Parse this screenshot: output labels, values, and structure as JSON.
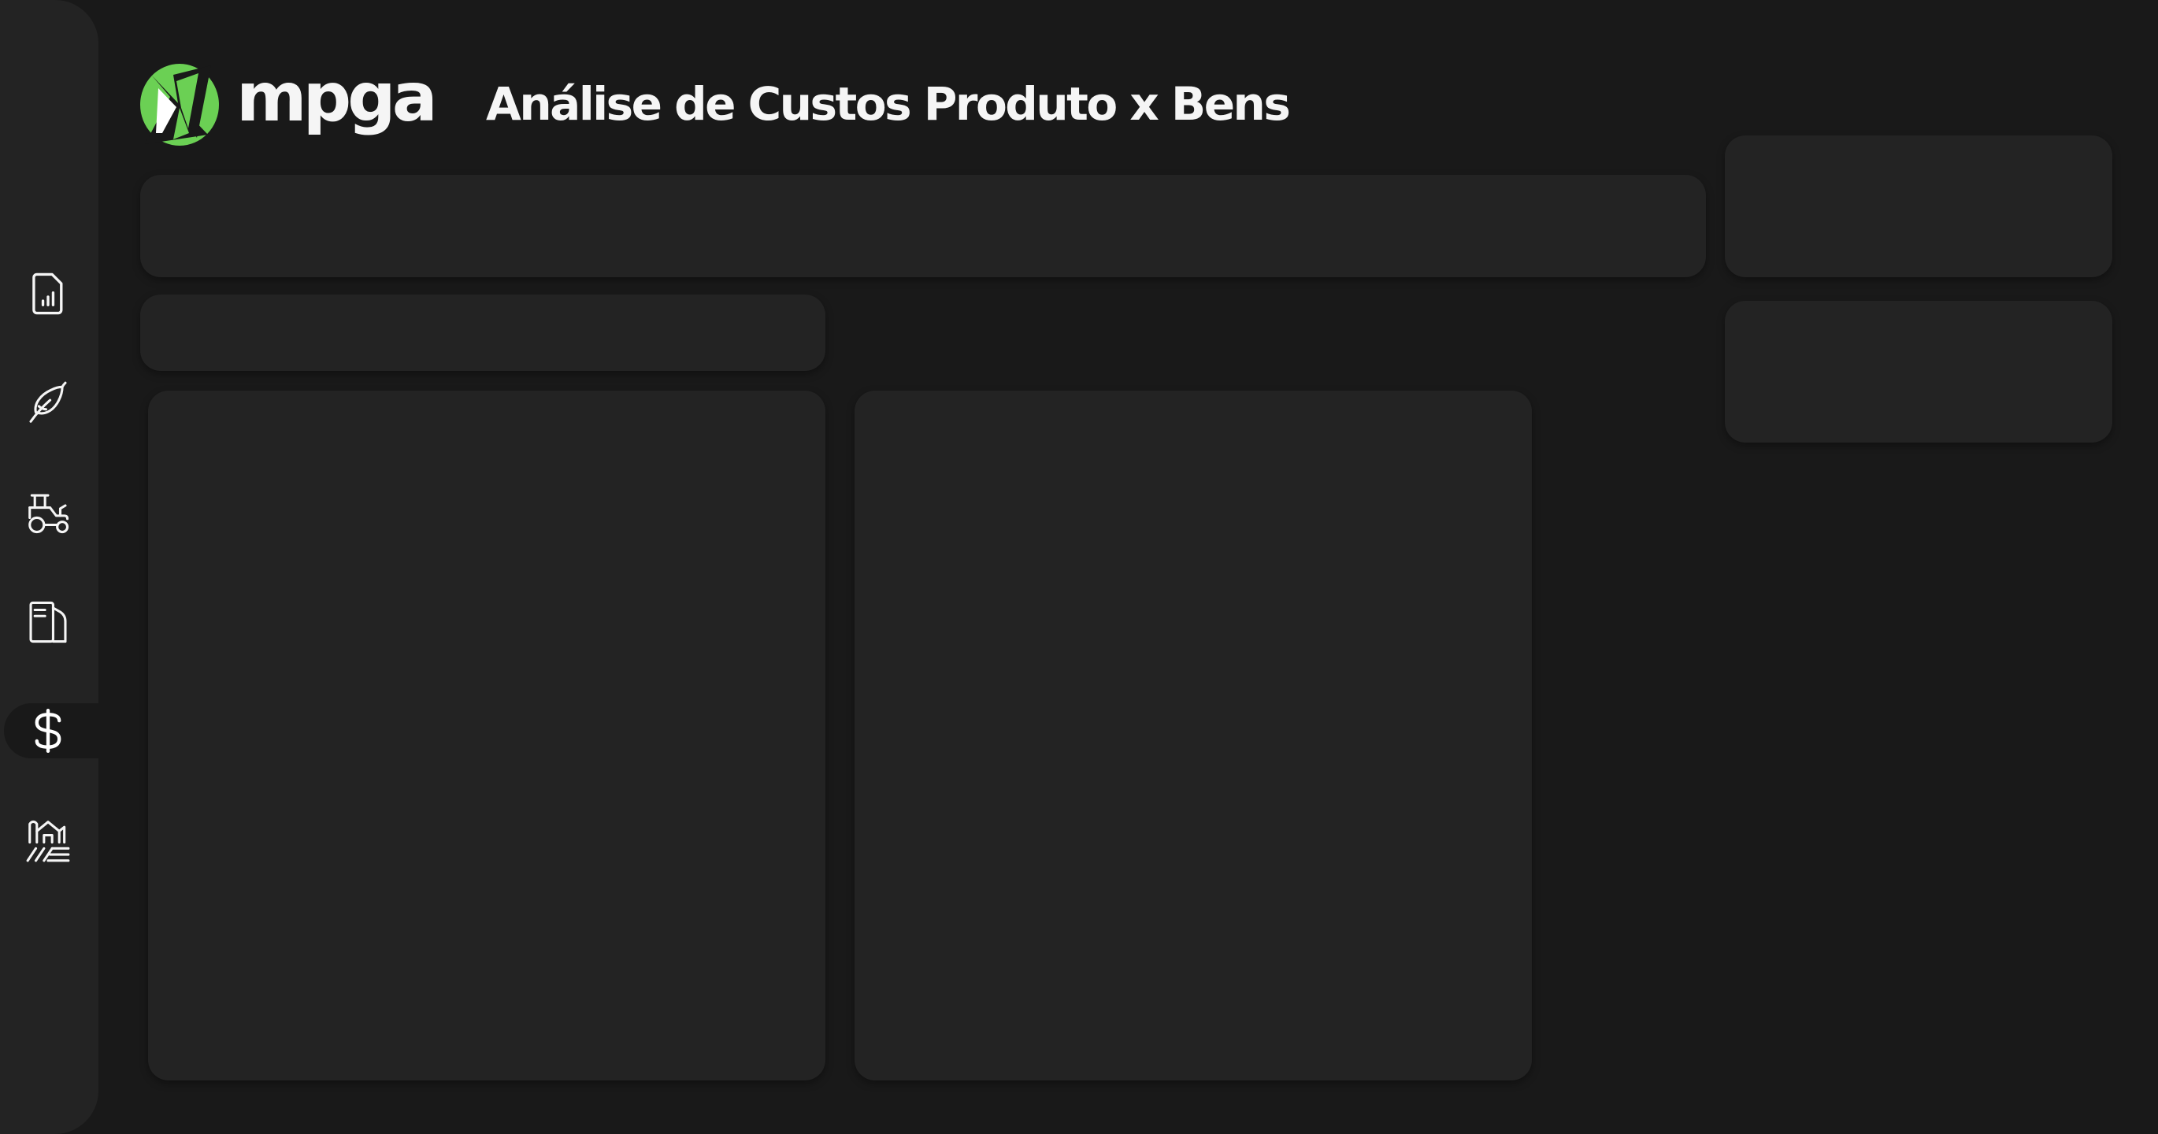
{
  "brand": {
    "name": "mpga",
    "accent": "#6bd054",
    "text_color": "#f5f5f5"
  },
  "header": {
    "title": "Análise de Custos Produto x Bens"
  },
  "theme": {
    "background": "#191919",
    "surface": "#232323"
  },
  "sidebar": {
    "items": [
      {
        "icon": "report-document-icon",
        "active": false
      },
      {
        "icon": "crop-leaf-icon",
        "active": false
      },
      {
        "icon": "tractor-icon",
        "active": false
      },
      {
        "icon": "fuel-pump-icon",
        "active": false
      },
      {
        "icon": "dollar-icon",
        "active": true
      },
      {
        "icon": "farm-field-icon",
        "active": false
      }
    ]
  }
}
